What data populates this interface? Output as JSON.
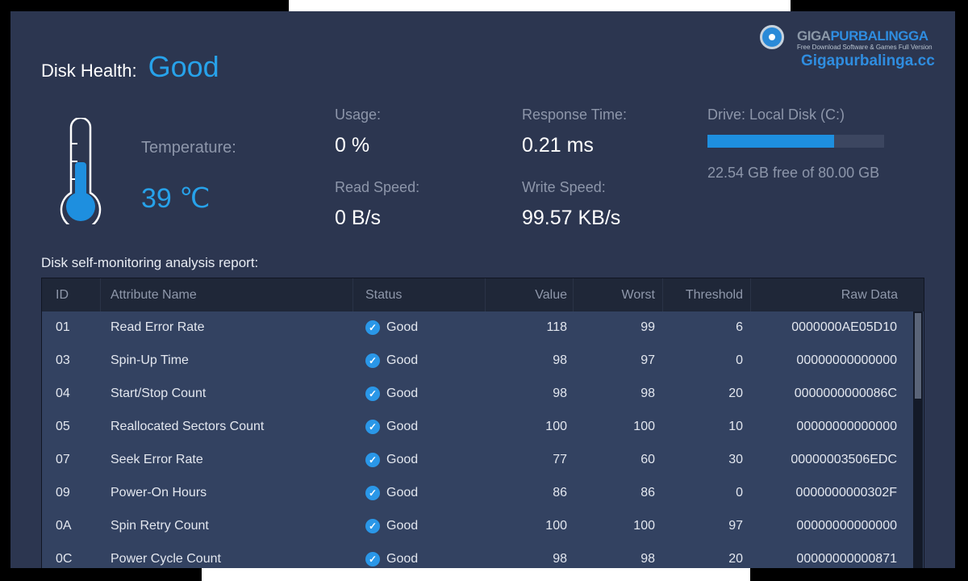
{
  "header": {
    "title_label": "Disk Health:",
    "title_value": "Good"
  },
  "watermark": {
    "giga": "GIGA",
    "purbalingga": "PURBALINGGA",
    "tagline": "Free Download Software & Games Full Version",
    "url": "Gigapurbalinga.cc"
  },
  "temperature": {
    "label": "Temperature:",
    "value": "39 ℃"
  },
  "stats": {
    "usage_label": "Usage:",
    "usage_value": "0 %",
    "response_label": "Response Time:",
    "response_value": "0.21 ms",
    "read_label": "Read Speed:",
    "read_value": "0 B/s",
    "write_label": "Write Speed:",
    "write_value": "99.57 KB/s"
  },
  "drive": {
    "label": "Drive:  Local Disk (C:)",
    "free_text": "22.54 GB free of 80.00 GB",
    "bar_fraction": 0.718
  },
  "report": {
    "title": "Disk self-monitoring analysis report:",
    "columns": [
      "ID",
      "Attribute Name",
      "Status",
      "Value",
      "Worst",
      "Threshold",
      "Raw Data"
    ],
    "rows": [
      {
        "id": "01",
        "name": "Read Error Rate",
        "status": "Good",
        "value": "118",
        "worst": "99",
        "threshold": "6",
        "raw": "0000000AE05D10"
      },
      {
        "id": "03",
        "name": "Spin-Up Time",
        "status": "Good",
        "value": "98",
        "worst": "97",
        "threshold": "0",
        "raw": "00000000000000"
      },
      {
        "id": "04",
        "name": "Start/Stop Count",
        "status": "Good",
        "value": "98",
        "worst": "98",
        "threshold": "20",
        "raw": "0000000000086C"
      },
      {
        "id": "05",
        "name": "Reallocated Sectors Count",
        "status": "Good",
        "value": "100",
        "worst": "100",
        "threshold": "10",
        "raw": "00000000000000"
      },
      {
        "id": "07",
        "name": "Seek Error Rate",
        "status": "Good",
        "value": "77",
        "worst": "60",
        "threshold": "30",
        "raw": "00000003506EDC"
      },
      {
        "id": "09",
        "name": "Power-On Hours",
        "status": "Good",
        "value": "86",
        "worst": "86",
        "threshold": "0",
        "raw": "0000000000302F"
      },
      {
        "id": "0A",
        "name": "Spin Retry Count",
        "status": "Good",
        "value": "100",
        "worst": "100",
        "threshold": "97",
        "raw": "00000000000000"
      },
      {
        "id": "0C",
        "name": "Power Cycle Count",
        "status": "Good",
        "value": "98",
        "worst": "98",
        "threshold": "20",
        "raw": "00000000000871"
      }
    ]
  },
  "colors": {
    "panel_bg": "#2c3650",
    "accent": "#27a2ea",
    "table_bg": "#334261",
    "header_bg": "#1f2738"
  }
}
